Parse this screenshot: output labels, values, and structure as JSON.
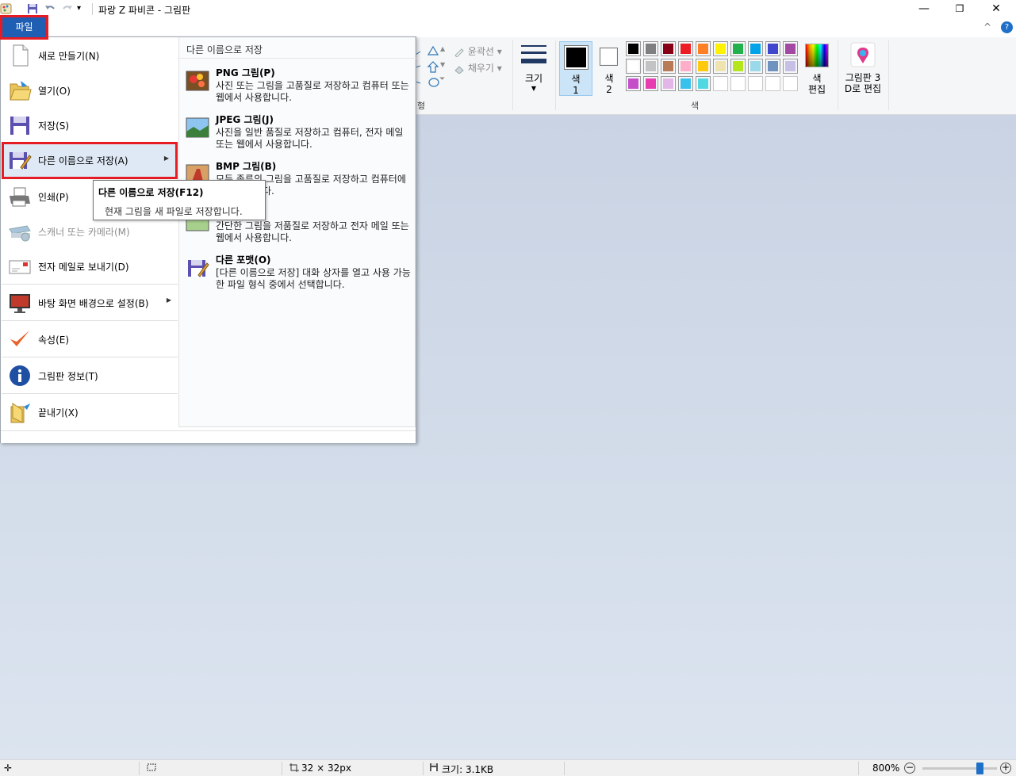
{
  "window": {
    "title": "파랑 Z 파비콘 - 그림판",
    "minimize": "—",
    "restore": "❐",
    "close": "✕",
    "help": "?",
    "collapse": "^"
  },
  "file_tab": {
    "label": "파일"
  },
  "ribbon": {
    "outline_label": "윤곽선",
    "fill_label": "채우기",
    "shapes_group_partial": "형",
    "size_label": "크기",
    "color1_label": "색\n1",
    "color2_label": "색\n2",
    "edit_colors_label": "색\n편집",
    "paint3d_label": "그림판 3\nD로 편집",
    "colors_group_label": "색",
    "palette": [
      [
        "#000000",
        "#7f7f7f",
        "#880015",
        "#ed1c24",
        "#ff7f27",
        "#fff200",
        "#22b14c",
        "#00a2e8",
        "#3f48cc",
        "#a349a4"
      ],
      [
        "#ffffff",
        "#c3c3c3",
        "#b97a57",
        "#ffaec9",
        "#ffc90e",
        "#efe4b0",
        "#b5e61d",
        "#99d9ea",
        "#7092be",
        "#c8bfe7"
      ],
      [
        "#c44fc9",
        "#e83db1",
        "#e4b6e8",
        "#38c1ec",
        "#4fd8e2",
        "",
        "",
        "",
        "",
        ""
      ]
    ],
    "color1": "#000000",
    "color2": "#ffffff"
  },
  "file_menu": {
    "items": [
      {
        "label": "새로 만들기(N)",
        "icon": "new-file-icon"
      },
      {
        "label": "열기(O)",
        "icon": "open-folder-icon"
      },
      {
        "label": "저장(S)",
        "icon": "save-disk-icon"
      },
      {
        "label": "다른 이름으로 저장(A)",
        "icon": "save-as-icon"
      },
      {
        "label": "인쇄(P)",
        "icon": "printer-icon"
      },
      {
        "label": "스캐너 또는 카메라(M)",
        "icon": "scanner-icon"
      },
      {
        "label": "전자 메일로 보내기(D)",
        "icon": "email-icon"
      },
      {
        "label": "바탕 화면 배경으로 설정(B)",
        "icon": "desktop-icon"
      },
      {
        "label": "속성(E)",
        "icon": "checkmark-icon"
      },
      {
        "label": "그림판 정보(T)",
        "icon": "info-icon"
      },
      {
        "label": "끝내기(X)",
        "icon": "exit-icon"
      }
    ],
    "submenu": {
      "header": "다른 이름으로 저장",
      "items": [
        {
          "title": "PNG 그림(P)",
          "desc": "사진 또는 그림을 고품질로 저장하고 컴퓨터 또는 웹에서 사용합니다."
        },
        {
          "title": "JPEG 그림(J)",
          "desc": "사진을 일반 품질로 저장하고 컴퓨터, 전자 메일 또는 웹에서 사용합니다."
        },
        {
          "title": "BMP 그림(B)",
          "desc": "모든 종류의 그림을 고품질로 저장하고 컴퓨터에서 사용합니다."
        },
        {
          "title": "",
          "desc": "간단한 그림을 저품질로 저장하고 전자 메일 또는 웹에서 사용합니다."
        },
        {
          "title": "다른 포맷(O)",
          "desc": "[다른 이름으로 저장] 대화 상자를 열고 사용 가능한 파일 형식 중에서 선택합니다."
        }
      ]
    }
  },
  "tooltip": {
    "title": "다른 이름으로 저장(F12)",
    "desc": "현재 그림을 새 파일로 저장합니다."
  },
  "status": {
    "dimensions": "32 × 32px",
    "size": "크기: 3.1KB",
    "zoom": "800%",
    "zoom_fraction": 0.8
  }
}
